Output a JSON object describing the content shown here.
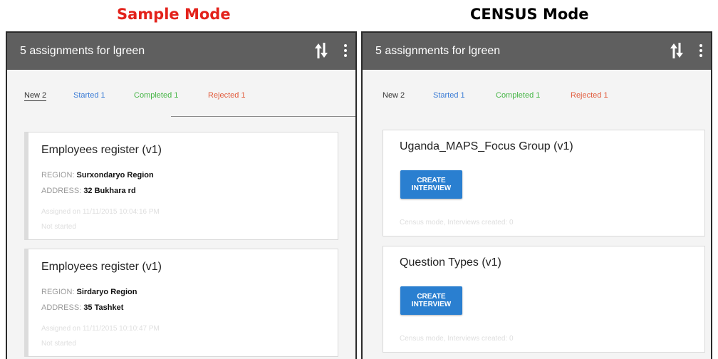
{
  "sample_title": "Sample Mode",
  "census_title": "CENSUS Mode",
  "sample": {
    "header": {
      "title": "5 assignments for lgreen",
      "sync_icon": "sync-icon",
      "more_icon": "more-vert-icon"
    },
    "tabs": {
      "new": "New 2",
      "started": "Started 1",
      "completed": "Completed 1",
      "rejected": "Rejected 1"
    },
    "cards": [
      {
        "title": "Employees register (v1)",
        "region_label": "REGION:",
        "region": "Surxondaryo Region",
        "address_label": "ADDRESS:",
        "address": "32 Bukhara rd",
        "assigned": "Assigned on 11/11/2015 10:04:16 PM",
        "status": "Not started"
      },
      {
        "title": "Employees register (v1)",
        "region_label": "REGION:",
        "region": "Sirdaryo Region",
        "address_label": "ADDRESS:",
        "address": "35 Tashket",
        "assigned": "Assigned on 11/11/2015 10:10:47 PM",
        "status": "Not started"
      }
    ]
  },
  "census": {
    "header": {
      "title": "5 assignments for lgreen",
      "sync_icon": "sync-icon",
      "more_icon": "more-vert-icon"
    },
    "tabs": {
      "new": "New 2",
      "started": "Started 1",
      "completed": "Completed 1",
      "rejected": "Rejected 1"
    },
    "cards": [
      {
        "title": "Uganda_MAPS_Focus Group (v1)",
        "button_line1": "CREATE",
        "button_line2": "INTERVIEW",
        "footer": "Census mode, Interviews created: 0"
      },
      {
        "title": "Question Types (v1)",
        "button_line1": "CREATE",
        "button_line2": "INTERVIEW",
        "footer": "Census mode, Interviews created: 0"
      }
    ]
  },
  "colors": {
    "sample_title": "#e3221b",
    "appbar": "#5f5f5f",
    "started": "#3a7bd5",
    "completed": "#45b545",
    "rejected": "#e15b3c",
    "button": "#2a7fd0"
  }
}
